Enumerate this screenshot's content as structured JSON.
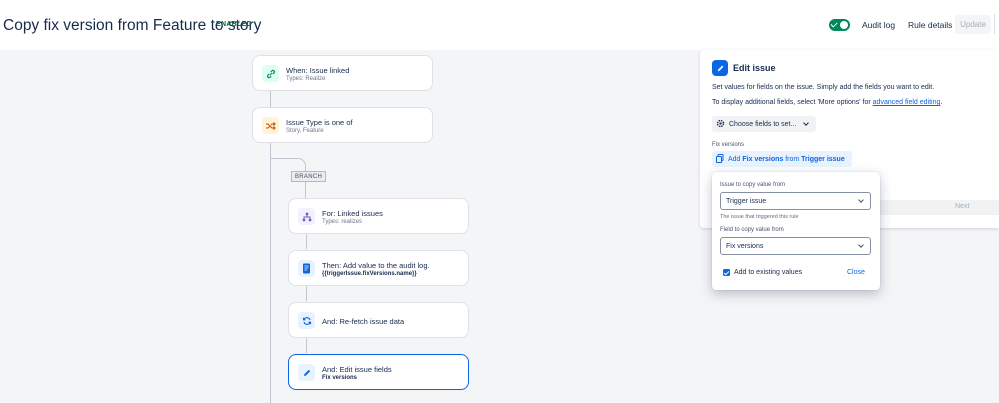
{
  "header": {
    "title": "Copy fix version from Feature to story",
    "status_badge": "ENABLED",
    "audit_log": "Audit log",
    "rule_details": "Rule details",
    "update": "Update"
  },
  "flow": {
    "branch_label": "BRANCH",
    "trigger": {
      "title": "When: Issue linked",
      "subtitle": "Types: Realize",
      "icon": "link-icon"
    },
    "condition": {
      "title": "Issue Type is one of",
      "subtitle": "Story, Feature",
      "icon": "shuffle-icon"
    },
    "branch_for": {
      "title": "For: Linked issues",
      "subtitle": "Types: realizes",
      "icon": "hierarchy-icon"
    },
    "audit": {
      "title": "Then: Add value to the audit log.",
      "subtitle": "{{triggerIssue.fixVersions.name}}",
      "icon": "document-icon"
    },
    "refetch": {
      "title": "And: Re-fetch issue data",
      "icon": "refresh-icon"
    },
    "edit": {
      "title": "And: Edit issue fields",
      "subtitle": "Fix versions",
      "icon": "pencil-icon"
    }
  },
  "panel": {
    "title": "Edit issue",
    "desc1": "Set values for fields on the issue. Simply add the fields you want to edit.",
    "desc2_prefix": "To display additional fields, select 'More options' for ",
    "desc2_link": "advanced field editing",
    "desc2_suffix": ".",
    "choose_fields": "Choose fields to set...",
    "fix_versions_label": "Fix versions",
    "add_prefix": "Add ",
    "add_field": "Fix versions",
    "add_middle": " from ",
    "add_source": "Trigger issue",
    "next": "Next"
  },
  "popup": {
    "copy_from_label": "Issue to copy value from",
    "copy_from_value": "Trigger issue",
    "copy_from_help": "The issue that triggered this rule",
    "field_label": "Field to copy value from",
    "field_value": "Fix versions",
    "add_existing_label": "Add to existing values",
    "add_existing_checked": true,
    "close": "Close"
  },
  "colors": {
    "accent": "#0c66e4",
    "enabled": "#006644",
    "toggle_on": "#00875a"
  }
}
